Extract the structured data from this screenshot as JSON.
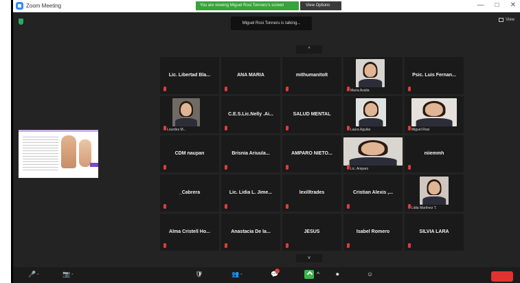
{
  "window": {
    "title": "Zoom Meeting",
    "talking_banner": "You are viewing Miguel Rosi Tonneru's screen",
    "view_options": "View Options",
    "controls": [
      "—",
      "□",
      "✕"
    ]
  },
  "meeting": {
    "speaking_toast": "Miguel Rosi Tonneru is talking...",
    "view_label": "View",
    "arrow_up": "^",
    "arrow_down": "v"
  },
  "gallery": {
    "tiles": [
      {
        "name": "Lic. Libertad Bla...",
        "video": false
      },
      {
        "name": "ANA MARÍA",
        "video": false
      },
      {
        "name": "mithumanitolt",
        "video": false
      },
      {
        "name": "",
        "video": true,
        "vname": "María Azalia"
      },
      {
        "name": "Psic. Luis Fernan...",
        "video": false
      },
      {
        "name": "",
        "video": true,
        "vname": "Lourdes M..."
      },
      {
        "name": "C.E.S.Lic.Nelly .Ai...",
        "video": false
      },
      {
        "name": "SALUD MENTAL",
        "video": false
      },
      {
        "name": "",
        "video": true,
        "vname": "Laura Aguilar"
      },
      {
        "name": "",
        "video": true,
        "vname": "Miguel Rosi"
      },
      {
        "name": "CDM naupan",
        "video": false
      },
      {
        "name": "Brisnia Ariuula...",
        "video": false
      },
      {
        "name": "AMPARO NIETO...",
        "video": false
      },
      {
        "name": "",
        "video": true,
        "vname": "Lic. Amparo"
      },
      {
        "name": "niiemmh",
        "video": false
      },
      {
        "name": "_Cabrera",
        "video": false
      },
      {
        "name": "Lic. Lidia L. Jime...",
        "video": false
      },
      {
        "name": "lexilltrades",
        "video": false
      },
      {
        "name": "Cristian Alexis ,...",
        "video": false
      },
      {
        "name": "",
        "video": true,
        "vname": "Lidia Martínez T."
      },
      {
        "name": "Alma Cristell Ho...",
        "video": false
      },
      {
        "name": "Anastacia De la...",
        "video": false
      },
      {
        "name": "JESUS",
        "video": false
      },
      {
        "name": "Isabel Romero",
        "video": false
      },
      {
        "name": "SILVIA LARA",
        "video": false
      }
    ]
  },
  "toolbar": {
    "mute": "🎤",
    "video": "📷",
    "security": "🛡",
    "participants": "👥",
    "chat": "💬",
    "record": "⏺",
    "reactions": "☺",
    "caret": "^"
  },
  "colors": {
    "meeting_bg": "#232323",
    "tile_bg": "#1a1a1a",
    "muted_red": "#e03c3c",
    "share_green": "#3bb54a",
    "end_red": "#e0332f"
  }
}
